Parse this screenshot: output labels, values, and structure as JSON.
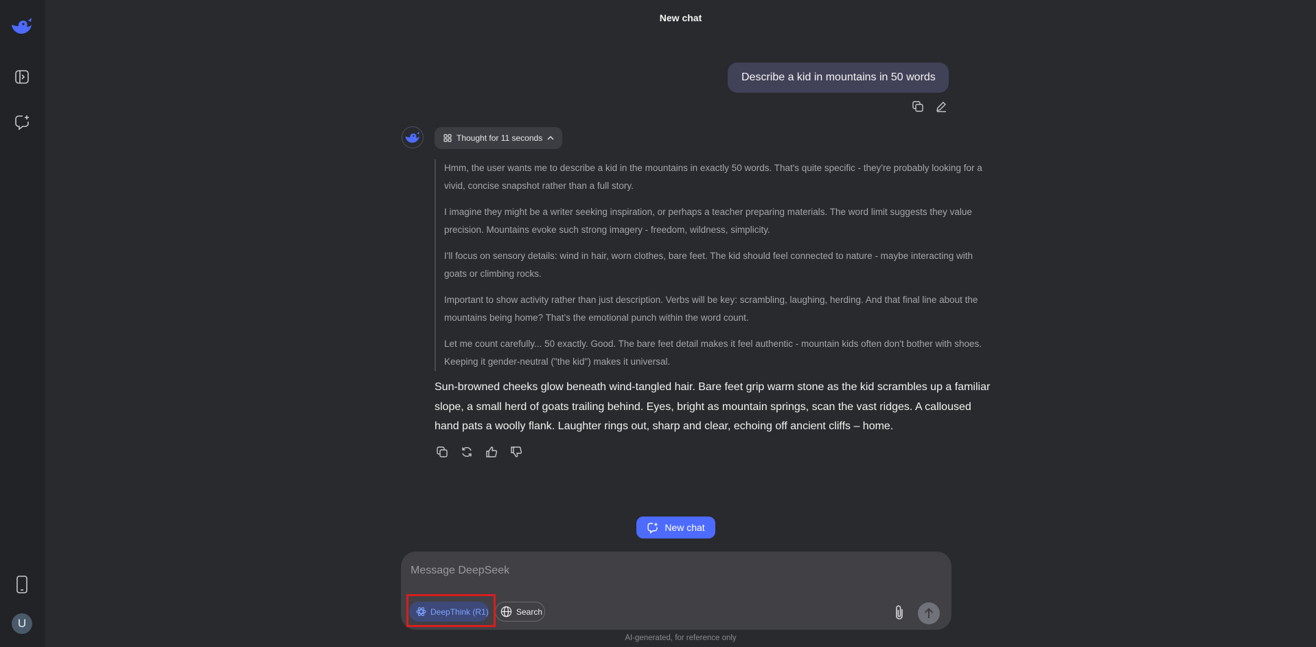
{
  "window": {
    "title": "New chat"
  },
  "sidebar": {
    "items": [
      {
        "icon": "deepseek-logo-icon"
      },
      {
        "icon": "open-sidebar-icon"
      },
      {
        "icon": "new-chat-icon"
      }
    ],
    "bottom": [
      {
        "icon": "mobile-app-icon"
      }
    ],
    "avatar_letter": "U"
  },
  "conversation": {
    "user_message": "Describe a kid in mountains in 50 words",
    "thought_label": "Thought for 11 seconds",
    "thinking": [
      "Hmm, the user wants me to describe a kid in the mountains in exactly 50 words. That's quite specific - they're probably looking for a vivid, concise snapshot rather than a full story.",
      "I imagine they might be a writer seeking inspiration, or perhaps a teacher preparing materials. The word limit suggests they value precision. Mountains evoke such strong imagery - freedom, wildness, simplicity.",
      "I'll focus on sensory details: wind in hair, worn clothes, bare feet. The kid should feel connected to nature - maybe interacting with goats or climbing rocks.",
      "Important to show activity rather than just description. Verbs will be key: scrambling, laughing, herding. And that final line about the mountains being home? That's the emotional punch within the word count.",
      "Let me count carefully... 50 exactly. Good. The bare feet detail makes it feel authentic - mountain kids often don't bother with shoes. Keeping it gender-neutral (\"the kid\") makes it universal."
    ],
    "answer": "Sun-browned cheeks glow beneath wind-tangled hair. Bare feet grip warm stone as the kid scrambles up a familiar slope, a small herd of goats trailing behind. Eyes, bright as mountain springs, scan the vast ridges. A calloused hand pats a woolly flank. Laughter rings out, sharp and clear, echoing off ancient cliffs – home."
  },
  "new_chat_label": "New chat",
  "composer": {
    "placeholder": "Message DeepSeek",
    "deepthink_label": "DeepThink (R1)",
    "search_label": "Search"
  },
  "disclaimer": "AI-generated, for reference only",
  "colors": {
    "accent": "#4d6bfe",
    "background": "#292a2d",
    "sidebar": "#212327",
    "highlight": "#d81e1e"
  }
}
